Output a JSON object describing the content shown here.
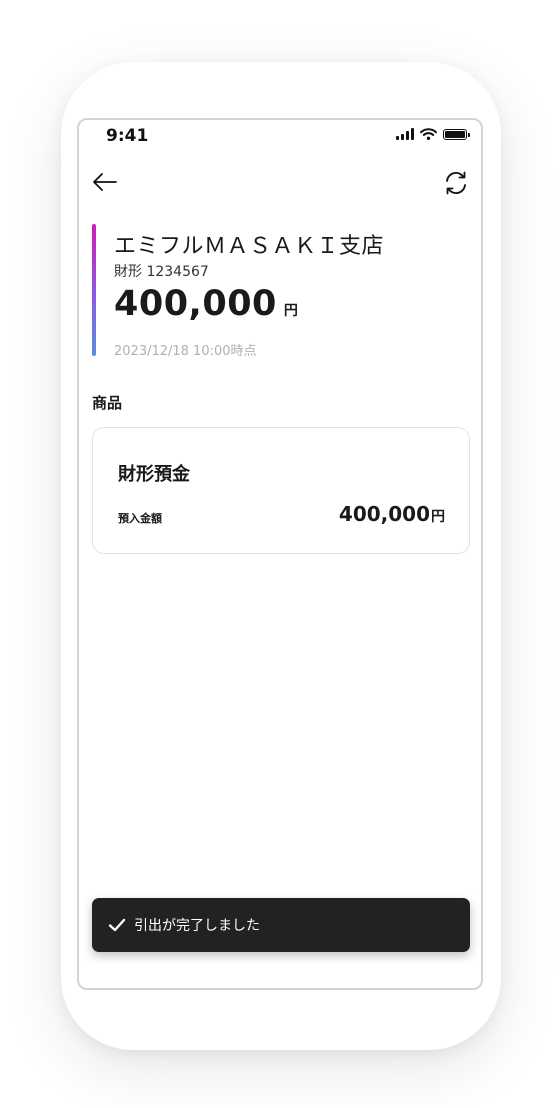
{
  "status_bar": {
    "time": "9:41"
  },
  "header": {
    "back_icon": "arrow-left-icon",
    "refresh_icon": "refresh-icon"
  },
  "account_summary": {
    "store_name": "エミフルＭＡＳＡＫＩ支店",
    "account_label": "財形 1234567",
    "balance_amount": "400,000",
    "balance_unit": "円",
    "as_of": "2023/12/18 10:00時点",
    "accent_gradient": [
      "#d21ab4",
      "#8b5ae6",
      "#5b8fd9"
    ]
  },
  "products": {
    "section_title": "商品",
    "items": [
      {
        "name": "財形預金",
        "detail_label": "預入金額",
        "amount": "400,000",
        "unit": "円"
      }
    ]
  },
  "toast": {
    "icon": "check-icon",
    "message": "引出が完了しました",
    "background": "#222222"
  }
}
